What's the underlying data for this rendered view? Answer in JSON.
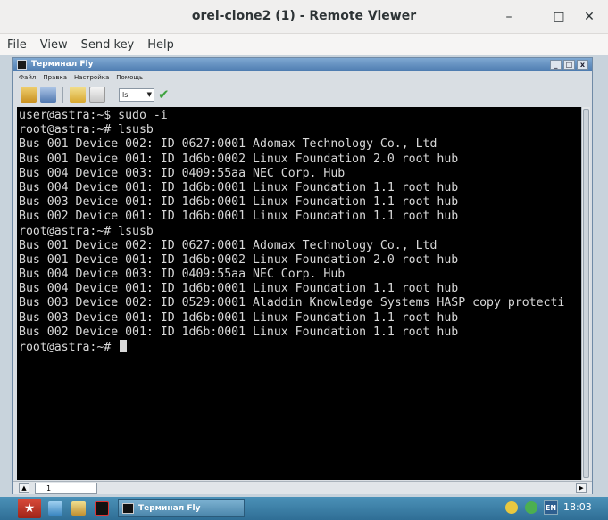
{
  "window": {
    "title": "orel-clone2 (1) - Remote Viewer",
    "minimize": "–",
    "maximize": "□",
    "close": "✕"
  },
  "menubar": {
    "items": [
      "File",
      "View",
      "Send key",
      "Help"
    ]
  },
  "terminal_window": {
    "title": "Терминал Fly",
    "menu": [
      "Файл",
      "Правка",
      "Настройка",
      "Помощь"
    ],
    "combo_value": "ls",
    "tab_label": "1",
    "lines": [
      "user@astra:~$ sudo -i",
      "root@astra:~# lsusb",
      "Bus 001 Device 002: ID 0627:0001 Adomax Technology Co., Ltd",
      "Bus 001 Device 001: ID 1d6b:0002 Linux Foundation 2.0 root hub",
      "Bus 004 Device 003: ID 0409:55aa NEC Corp. Hub",
      "Bus 004 Device 001: ID 1d6b:0001 Linux Foundation 1.1 root hub",
      "Bus 003 Device 001: ID 1d6b:0001 Linux Foundation 1.1 root hub",
      "Bus 002 Device 001: ID 1d6b:0001 Linux Foundation 1.1 root hub",
      "root@astra:~# lsusb",
      "Bus 001 Device 002: ID 0627:0001 Adomax Technology Co., Ltd",
      "Bus 001 Device 001: ID 1d6b:0002 Linux Foundation 2.0 root hub",
      "Bus 004 Device 003: ID 0409:55aa NEC Corp. Hub",
      "Bus 004 Device 001: ID 1d6b:0001 Linux Foundation 1.1 root hub",
      "Bus 003 Device 002: ID 0529:0001 Aladdin Knowledge Systems HASP copy protecti",
      "Bus 003 Device 001: ID 1d6b:0001 Linux Foundation 1.1 root hub",
      "Bus 002 Device 001: ID 1d6b:0001 Linux Foundation 1.1 root hub"
    ],
    "prompt": "root@astra:~# "
  },
  "taskbar": {
    "task_label": "Терминал Fly",
    "lang": "EN",
    "clock": "18:03"
  }
}
